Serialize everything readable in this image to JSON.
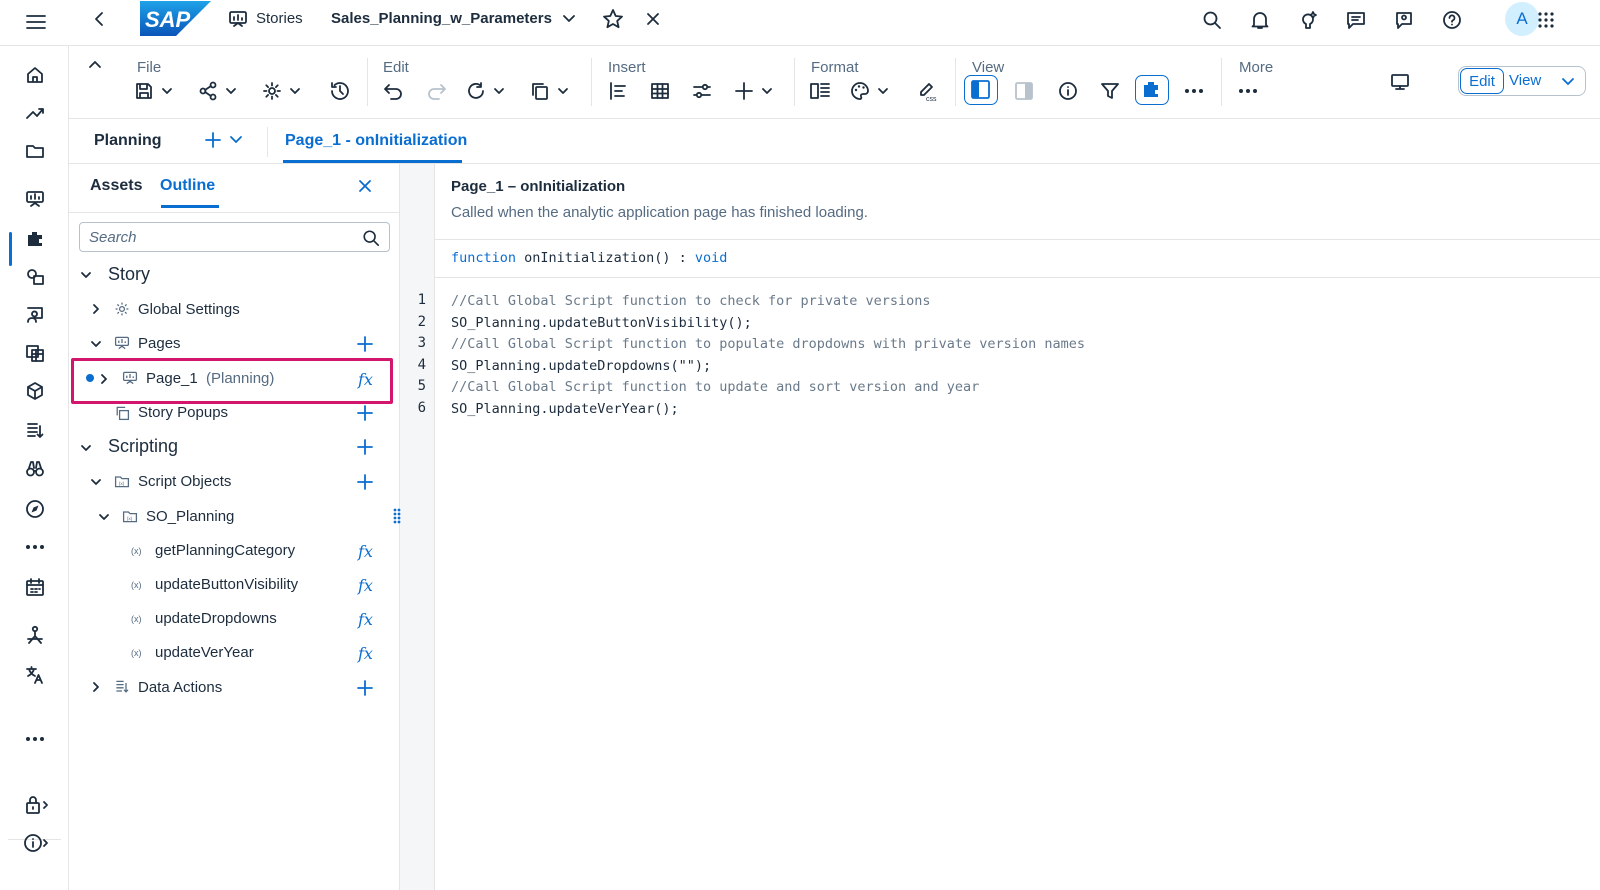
{
  "shell": {
    "logo_text": "SAP",
    "stories_label": "Stories",
    "story_title": "Sales_Planning_w_Parameters",
    "avatar_initial": "A"
  },
  "toolbar": {
    "groups": {
      "file": "File",
      "edit": "Edit",
      "insert": "Insert",
      "format": "Format",
      "view": "View",
      "more": "More"
    },
    "edit_label": "Edit",
    "view_label": "View"
  },
  "tabs": {
    "planning": "Planning",
    "page": "Page_1 - onInitialization"
  },
  "panel": {
    "tab_assets": "Assets",
    "tab_outline": "Outline",
    "search_placeholder": "Search",
    "tree": {
      "story": "Story",
      "global_settings": "Global Settings",
      "pages": "Pages",
      "page1": "Page_1",
      "page1_tag": "(Planning)",
      "story_popups": "Story Popups",
      "scripting": "Scripting",
      "script_objects": "Script Objects",
      "so_planning": "SO_Planning",
      "fn1": "getPlanningCategory",
      "fn2": "updateButtonVisibility",
      "fn3": "updateDropdowns",
      "fn4": "updateVerYear",
      "data_actions": "Data Actions"
    }
  },
  "editor": {
    "event_title": "Page_1 – onInitialization",
    "event_desc": "Called when the analytic application page has finished loading.",
    "signature": {
      "keyword": "function",
      "name": " onInitialization() : ",
      "return_type": "void"
    },
    "lines": [
      {
        "n": "1",
        "text": "//Call Global Script function to check for private versions"
      },
      {
        "n": "2",
        "text": "SO_Planning.updateButtonVisibility();"
      },
      {
        "n": "3",
        "text": "//Call Global Script function to populate dropdowns with private version names"
      },
      {
        "n": "4",
        "text": "SO_Planning.updateDropdowns(\"\");"
      },
      {
        "n": "5",
        "text": "//Call Global Script function to update and sort version and year"
      },
      {
        "n": "6",
        "text": "SO_Planning.updateVerYear();"
      }
    ]
  },
  "colors": {
    "accent": "#0a6ed1",
    "highlight": "#d3156e",
    "text": "#1d2d3e",
    "muted": "#556b82"
  }
}
